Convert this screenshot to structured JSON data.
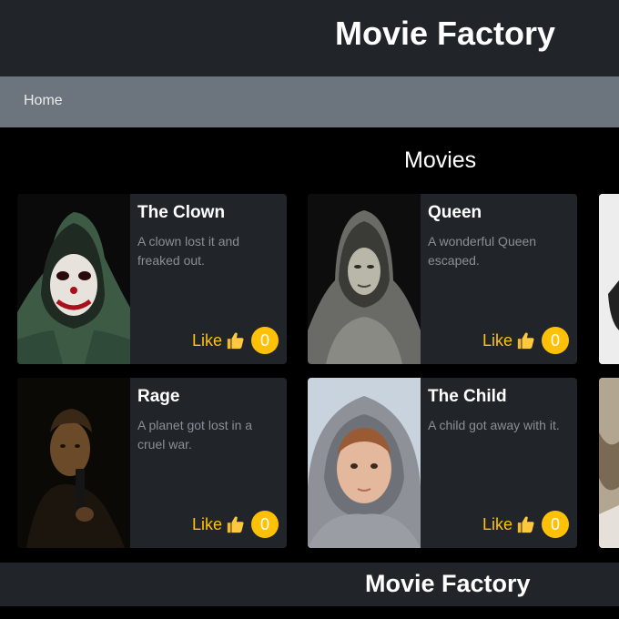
{
  "header": {
    "title": "Movie Factory"
  },
  "nav": {
    "home_label": "Home"
  },
  "main": {
    "section_title": "Movies",
    "like_label": "Like",
    "movies": [
      {
        "title": "The Clown",
        "description": "A clown lost it and freaked out.",
        "likes": "0",
        "poster_icon": "clown-poster"
      },
      {
        "title": "Queen",
        "description": "A wonderful Queen escaped.",
        "likes": "0",
        "poster_icon": "queen-poster"
      },
      {
        "title": "Rage",
        "description": "A planet got lost in a cruel war.",
        "likes": "0",
        "poster_icon": "rage-poster"
      },
      {
        "title": "The Child",
        "description": "A child got away with it.",
        "likes": "0",
        "poster_icon": "child-poster"
      }
    ]
  },
  "footer": {
    "title": "Movie Factory"
  },
  "colors": {
    "accent": "#ffc107",
    "header_bg": "#212529",
    "nav_bg": "#6c757d",
    "card_bg": "#212529",
    "page_bg": "#000000"
  }
}
